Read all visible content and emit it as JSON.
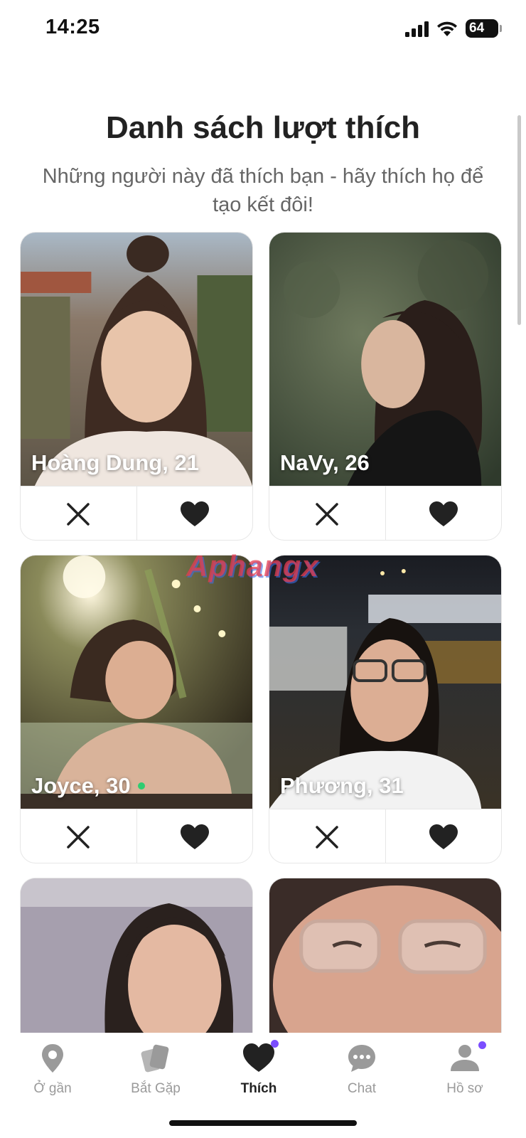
{
  "status_bar": {
    "time": "14:25",
    "battery": "64"
  },
  "header": {
    "title": "Danh sách lượt thích",
    "subtitle": "Những người này đã thích bạn - hãy thích họ để tạo kết đôi!"
  },
  "profiles": [
    {
      "name": "Hoàng Dung, 21",
      "online": false
    },
    {
      "name": "NaVy, 26",
      "online": false
    },
    {
      "name": "Joyce, 30",
      "online": true
    },
    {
      "name": "Phương, 31",
      "online": false
    }
  ],
  "watermark": "Aphangx",
  "nav": {
    "items": [
      {
        "label": "Ở gần",
        "icon": "location-pin-icon"
      },
      {
        "label": "Bắt Gặp",
        "icon": "cards-icon"
      },
      {
        "label": "Thích",
        "icon": "heart-icon",
        "active": true
      },
      {
        "label": "Chat",
        "icon": "chat-bubble-icon"
      },
      {
        "label": "Hồ sơ",
        "icon": "profile-icon"
      }
    ]
  },
  "colors": {
    "accent": "#7b4dff",
    "online": "#2ecc71"
  }
}
